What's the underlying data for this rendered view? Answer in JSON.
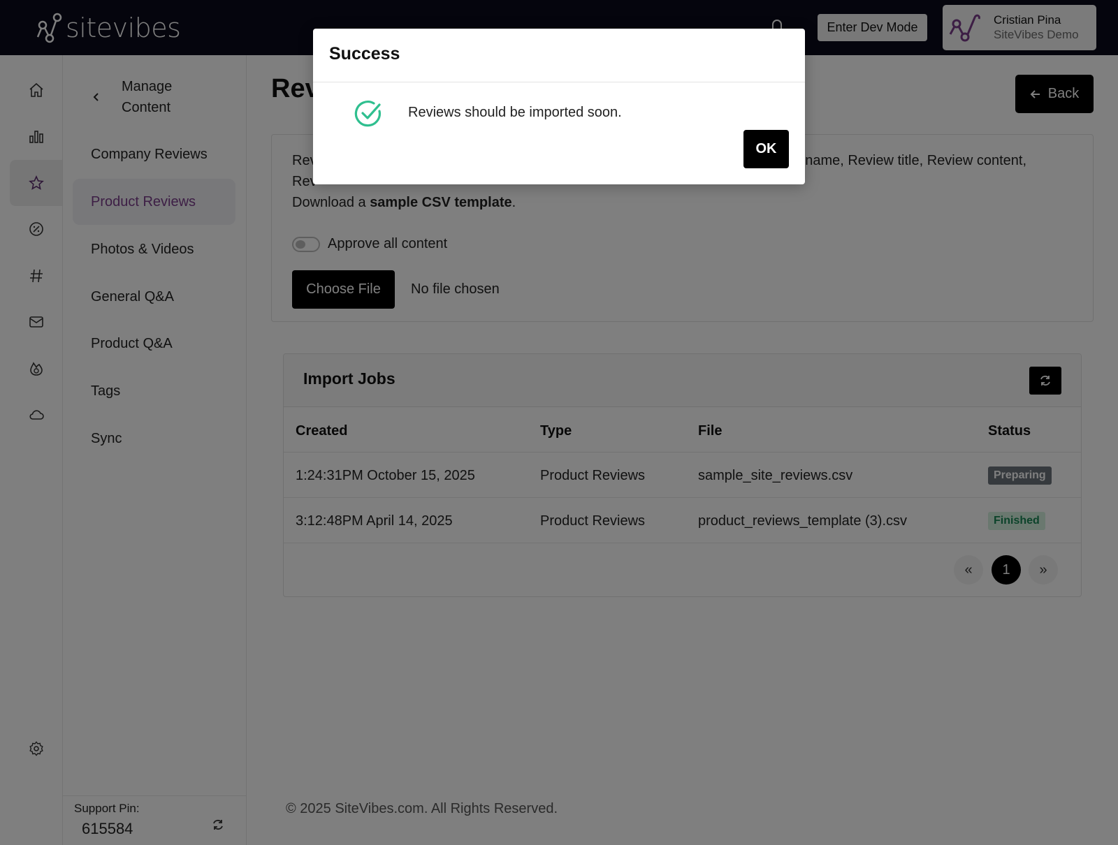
{
  "brand": {
    "name": "sitevibes"
  },
  "topbar": {
    "dev_mode_label": "Enter Dev Mode",
    "user_name": "Cristian Pina",
    "user_org": "SiteVibes Demo"
  },
  "rail": {
    "items": [
      "home-icon",
      "bar-chart-icon",
      "star-icon",
      "percent-badge-icon",
      "hashtag-icon",
      "mail-icon",
      "fire-icon",
      "cloud-icon",
      "gear-icon"
    ],
    "active": "star-icon"
  },
  "subnav": {
    "back_title": "Manage Content",
    "items": [
      {
        "label": "Company Reviews"
      },
      {
        "label": "Product Reviews"
      },
      {
        "label": "Photos & Videos"
      },
      {
        "label": "General Q&A"
      },
      {
        "label": "Product Q&A"
      },
      {
        "label": "Tags"
      },
      {
        "label": "Sync"
      }
    ],
    "active_item": "Product Reviews",
    "support_label": "Support Pin:",
    "support_pin": "615584"
  },
  "main": {
    "title": "Rev",
    "back_label": "Back",
    "upload": {
      "desc_line1_start": "Rev",
      "desc_line1_end": "r name, Review title, Review content,",
      "desc_line2": "Rev",
      "desc_line3_prefix": "Download a ",
      "desc_line3_link": "sample CSV template",
      "desc_line3_suffix": ".",
      "approve_label": "Approve all content",
      "choose_file_label": "Choose File",
      "file_status": "No file chosen"
    },
    "jobs": {
      "title": "Import Jobs",
      "columns": [
        "Created",
        "Type",
        "File",
        "Status"
      ],
      "rows": [
        {
          "created": "1:24:31PM October 15, 2025",
          "type": "Product Reviews",
          "file": "sample_site_reviews.csv",
          "status": "Preparing"
        },
        {
          "created": "3:12:48PM April 14, 2025",
          "type": "Product Reviews",
          "file": "product_reviews_template (3).csv",
          "status": "Finished"
        }
      ],
      "pager": {
        "prev": "«",
        "current": "1",
        "next": "»"
      }
    },
    "footer": "© 2025 SiteVibes.com. All Rights Reserved."
  },
  "modal": {
    "title": "Success",
    "message": "Reviews should be imported soon.",
    "ok_label": "OK"
  },
  "colors": {
    "topbar": "#0b0b1a",
    "accent_purple": "#7a3d8a",
    "success_green": "#2fbf8f",
    "finished_badge_text": "#198754",
    "preparing_badge_bg": "#6c757d"
  }
}
